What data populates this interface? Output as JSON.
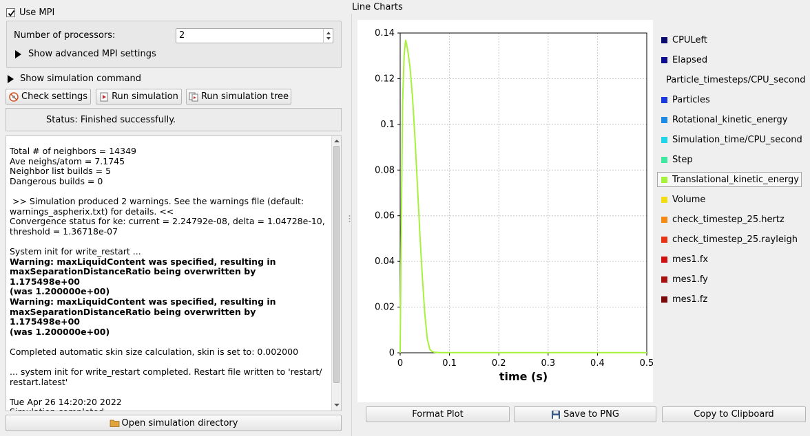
{
  "mpi": {
    "use_mpi_label": "Use MPI",
    "use_mpi_checked": true,
    "num_processors_label": "Number of processors:",
    "num_processors_value": "2",
    "advanced_label": "Show advanced MPI settings"
  },
  "sim_command_label": "Show simulation command",
  "buttons": {
    "check_settings": "Check settings",
    "run_simulation": "Run simulation",
    "run_simulation_tree": "Run simulation tree",
    "open_directory": "Open simulation directory",
    "format_plot": "Format Plot",
    "save_png": "Save to PNG",
    "copy_clipboard": "Copy to Clipboard"
  },
  "status_text": "Status: Finished successfully.",
  "log": [
    {
      "text": "Total # of neighbors = 14349",
      "bold": false
    },
    {
      "text": "Ave neighs/atom = 7.1745",
      "bold": false
    },
    {
      "text": "Neighbor list builds = 5",
      "bold": false
    },
    {
      "text": "Dangerous builds = 0",
      "bold": false
    },
    {
      "text": "",
      "bold": false
    },
    {
      "text": " >> Simulation produced 2 warnings. See the warnings file (default:\nwarnings_aspherix.txt) for details. <<",
      "bold": false
    },
    {
      "text": "Convergence status for ke: current = 2.24792e-08, delta = 1.04728e-10,\nthreshold = 1.36718e-07",
      "bold": false
    },
    {
      "text": "",
      "bold": false
    },
    {
      "text": "System init for write_restart ...",
      "bold": false
    },
    {
      "text": "Warning: maxLiquidContent was specified, resulting in\nmaxSeparationDistanceRatio being overwritten by 1.175498e+00\n(was 1.200000e+00)",
      "bold": true
    },
    {
      "text": "Warning: maxLiquidContent was specified, resulting in\nmaxSeparationDistanceRatio being overwritten by 1.175498e+00\n(was 1.200000e+00)",
      "bold": true
    },
    {
      "text": "",
      "bold": false
    },
    {
      "text": "Completed automatic skin size calculation, skin is set to: 0.002000",
      "bold": false
    },
    {
      "text": "",
      "bold": false
    },
    {
      "text": "... system init for write_restart completed. Restart file written to 'restart/\nrestart.latest'",
      "bold": false
    },
    {
      "text": "",
      "bold": false
    },
    {
      "text": "Tue Apr 26 14:20:20 2022",
      "bold": false
    },
    {
      "text": "Simulation completed",
      "bold": false
    }
  ],
  "panel_title": "Line Charts",
  "legend": [
    {
      "label": "CPULeft",
      "color": "#0b0b6e"
    },
    {
      "label": "Elapsed",
      "color": "#0d0d8f"
    },
    {
      "label": "Particle_timesteps/CPU_second",
      "color": "#1010c0"
    },
    {
      "label": "Particles",
      "color": "#1a3ae0"
    },
    {
      "label": "Rotational_kinetic_energy",
      "color": "#1e8ae8"
    },
    {
      "label": "Simulation_time/CPU_second",
      "color": "#1fd6e8"
    },
    {
      "label": "Step",
      "color": "#3ee8a0"
    },
    {
      "label": "Translational_kinetic_energy",
      "color": "#a6f23a",
      "selected": true
    },
    {
      "label": "Volume",
      "color": "#f2dc14"
    },
    {
      "label": "check_timestep_25.hertz",
      "color": "#f28a14"
    },
    {
      "label": "check_timestep_25.rayleigh",
      "color": "#e83214"
    },
    {
      "label": "mes1.fx",
      "color": "#d01010"
    },
    {
      "label": "mes1.fy",
      "color": "#a81010"
    },
    {
      "label": "mes1.fz",
      "color": "#7a0a0a"
    }
  ],
  "chart_data": {
    "type": "line",
    "xlabel": "time (s)",
    "ylabel": "",
    "xlim": [
      0,
      0.5
    ],
    "ylim": [
      0,
      0.14
    ],
    "xticks": [
      "0",
      "0.1",
      "0.2",
      "0.3",
      "0.4",
      "0.5"
    ],
    "yticks": [
      "0",
      "0.02",
      "0.04",
      "0.06",
      "0.08",
      "0.1",
      "0.12",
      "0.14"
    ],
    "grid": true,
    "series": [
      {
        "name": "Translational_kinetic_energy",
        "color": "#a6f23a",
        "x": [
          0,
          0.002,
          0.005,
          0.008,
          0.011,
          0.015,
          0.02,
          0.025,
          0.03,
          0.035,
          0.04,
          0.045,
          0.05,
          0.055,
          0.06,
          0.065,
          0.07,
          0.08,
          0.1,
          0.2,
          0.3,
          0.4,
          0.5
        ],
        "values": [
          0,
          0.05,
          0.11,
          0.13,
          0.137,
          0.133,
          0.125,
          0.112,
          0.094,
          0.073,
          0.052,
          0.033,
          0.017,
          0.006,
          0.0015,
          0.0005,
          0.0002,
          0.0001,
          0.0001,
          0.0001,
          0.0001,
          0.0001,
          0.0001
        ]
      }
    ]
  }
}
